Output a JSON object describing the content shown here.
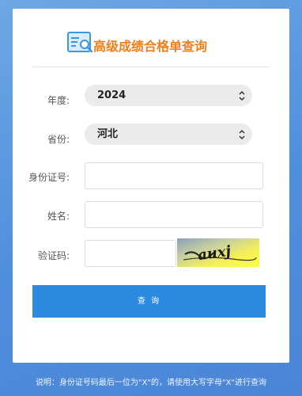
{
  "header": {
    "title": "高级成绩合格单查询",
    "logo_icon": "certificate-search-icon",
    "title_color": "#f07f1a"
  },
  "form": {
    "year_label": "年度:",
    "year_value": "2024",
    "province_label": "省份:",
    "province_value": "河北",
    "id_label": "身份证号:",
    "id_value": "",
    "name_label": "姓名:",
    "name_value": "",
    "captcha_label": "验证码:",
    "captcha_value": "",
    "captcha_text": "auxj",
    "submit_label": "查 询"
  },
  "note": "说明：身份证号码最后一位为\"X\"的，请使用大写字母\"X\"进行查询",
  "colors": {
    "accent": "#2c8ae0",
    "background": "#5a97e0"
  }
}
